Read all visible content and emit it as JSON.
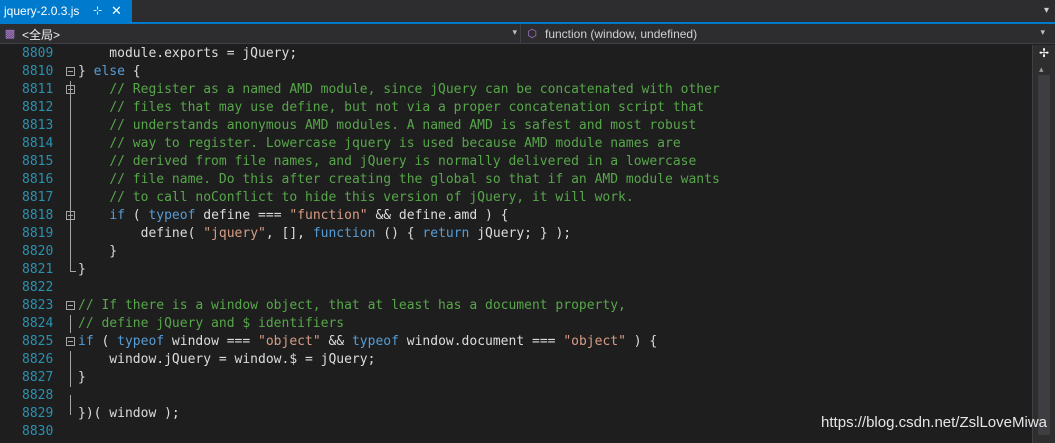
{
  "tab": {
    "title": "jquery-2.0.3.js",
    "pin_glyph": "⊹",
    "close_glyph": "✕",
    "dropdown_glyph": "▾"
  },
  "navbar": {
    "scope_label": "<全局>",
    "member_label": "function (window, undefined)",
    "arrow_glyph": "▾"
  },
  "editor": {
    "lines": [
      {
        "n": "8809",
        "code": "    module.exports = jQuery;"
      },
      {
        "n": "8810",
        "code": "} else {"
      },
      {
        "n": "8811",
        "code": "    // Register as a named AMD module, since jQuery can be concatenated with other"
      },
      {
        "n": "8812",
        "code": "    // files that may use define, but not via a proper concatenation script that"
      },
      {
        "n": "8813",
        "code": "    // understands anonymous AMD modules. A named AMD is safest and most robust"
      },
      {
        "n": "8814",
        "code": "    // way to register. Lowercase jquery is used because AMD module names are"
      },
      {
        "n": "8815",
        "code": "    // derived from file names, and jQuery is normally delivered in a lowercase"
      },
      {
        "n": "8816",
        "code": "    // file name. Do this after creating the global so that if an AMD module wants"
      },
      {
        "n": "8817",
        "code": "    // to call noConflict to hide this version of jQuery, it will work."
      },
      {
        "n": "8818",
        "code": "    if ( typeof define === \"function\" && define.amd ) {"
      },
      {
        "n": "8819",
        "code": "        define( \"jquery\", [], function () { return jQuery; } );"
      },
      {
        "n": "8820",
        "code": "    }"
      },
      {
        "n": "8821",
        "code": "}"
      },
      {
        "n": "8822",
        "code": ""
      },
      {
        "n": "8823",
        "code": "// If there is a window object, that at least has a document property,"
      },
      {
        "n": "8824",
        "code": "// define jQuery and $ identifiers"
      },
      {
        "n": "8825",
        "code": "if ( typeof window === \"object\" && typeof window.document === \"object\" ) {"
      },
      {
        "n": "8826",
        "code": "    window.jQuery = window.$ = jQuery;"
      },
      {
        "n": "8827",
        "code": "}"
      },
      {
        "n": "8828",
        "code": ""
      },
      {
        "n": "8829",
        "code": "})( window );"
      },
      {
        "n": "8830",
        "code": ""
      }
    ]
  },
  "scrollbar": {
    "split_glyph": "✢",
    "up_glyph": "▴"
  },
  "watermark": "https://blog.csdn.net/ZslLoveMiwa",
  "colors": {
    "background": "#1e1e1e",
    "tab_active": "#007acc",
    "line_number": "#2b91af",
    "keyword": "#569cd6",
    "string": "#d69d85",
    "comment": "#57a64a",
    "text": "#dcdcdc"
  }
}
